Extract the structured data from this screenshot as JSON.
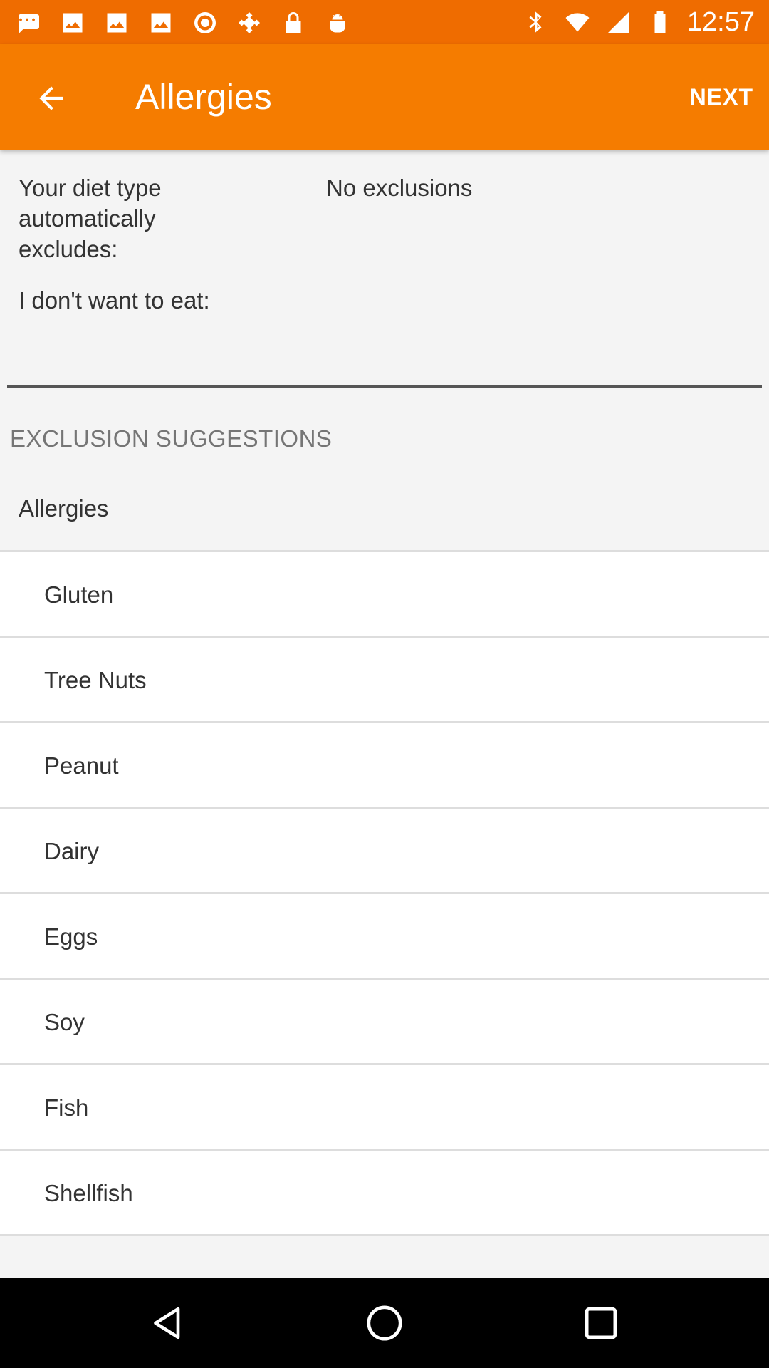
{
  "status_bar": {
    "time": "12:57",
    "left_icons": [
      "message-icon",
      "image-icon",
      "image-icon",
      "image-icon",
      "target-icon",
      "fake-gps-icon",
      "lock-icon",
      "android-icon"
    ],
    "right_icons": [
      "bluetooth-icon",
      "wifi-icon",
      "signal-icon",
      "battery-icon"
    ]
  },
  "appbar": {
    "title": "Allergies",
    "next_label": "NEXT",
    "color": "#f57c00"
  },
  "diet": {
    "excludes_label": "Your diet type automatically excludes:",
    "excludes_value": "No exclusions",
    "dont_want_label": "I don't want to eat:",
    "dont_want_value": ""
  },
  "suggestions": {
    "header": "EXCLUSION SUGGESTIONS",
    "group_label": "Allergies",
    "items": [
      "Gluten",
      "Tree Nuts",
      "Peanut",
      "Dairy",
      "Eggs",
      "Soy",
      "Fish",
      "Shellfish"
    ]
  },
  "nav_bar": {
    "buttons": [
      "back-triangle-icon",
      "home-circle-icon",
      "recents-square-icon"
    ]
  }
}
